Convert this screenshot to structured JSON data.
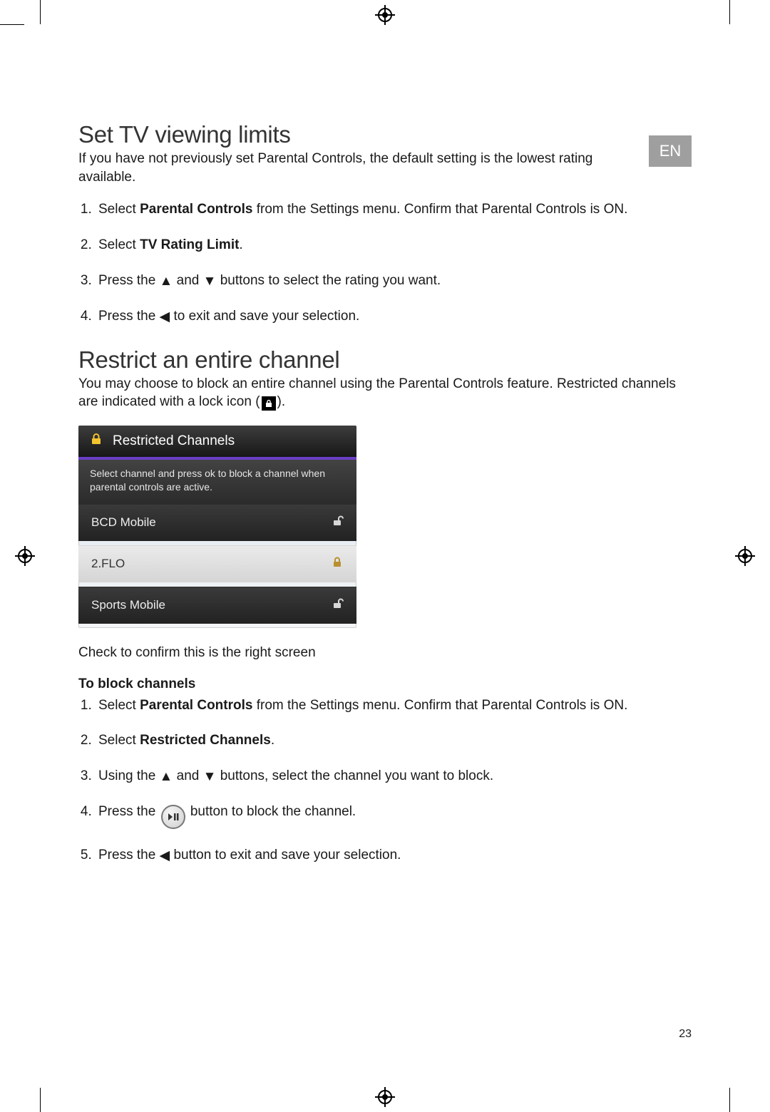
{
  "lang_tab": "EN",
  "page_number": "23",
  "section1": {
    "heading": "Set TV viewing limits",
    "intro": "If you have not previously set Parental Controls, the default setting is the lowest rating available.",
    "steps": {
      "s1a": "Select ",
      "s1b": "Parental Controls",
      "s1c": " from the Settings menu. Confirm that Parental Controls is ON.",
      "s2a": "Select ",
      "s2b": "TV Rating Limit",
      "s2c": ".",
      "s3a": "Press the ",
      "s3b": " and ",
      "s3c": " buttons to select the rating you want.",
      "s4a": "Press the ",
      "s4b": " to exit and save your selection."
    }
  },
  "section2": {
    "heading": "Restrict an entire channel",
    "intro_a": "You may choose to block an entire channel using the Parental Controls feature. Restricted channels are indicated with a lock icon (",
    "intro_b": ").",
    "caption": "Check to confirm this is the right screen",
    "subhead": "To block channels",
    "steps": {
      "s1a": "Select ",
      "s1b": "Parental Controls",
      "s1c": " from the Settings menu. Confirm that Parental Controls is ON.",
      "s2a": "Select ",
      "s2b": "Restricted Channels",
      "s2c": ".",
      "s3a": "Using the ",
      "s3b": " and ",
      "s3c": " buttons, select the channel you want to block.",
      "s4a": "Press the ",
      "s4b": " button to block the channel.",
      "s5a": "Press the ",
      "s5b": " button to exit and save your selection."
    }
  },
  "device": {
    "title": "Restricted Channels",
    "hint": "Select channel and press ok to block a channel when parental controls are active.",
    "rows": [
      {
        "label": "BCD Mobile",
        "locked": false,
        "selected": false
      },
      {
        "label": "2.FLO",
        "locked": true,
        "selected": true
      },
      {
        "label": "Sports Mobile",
        "locked": false,
        "selected": false
      }
    ]
  }
}
